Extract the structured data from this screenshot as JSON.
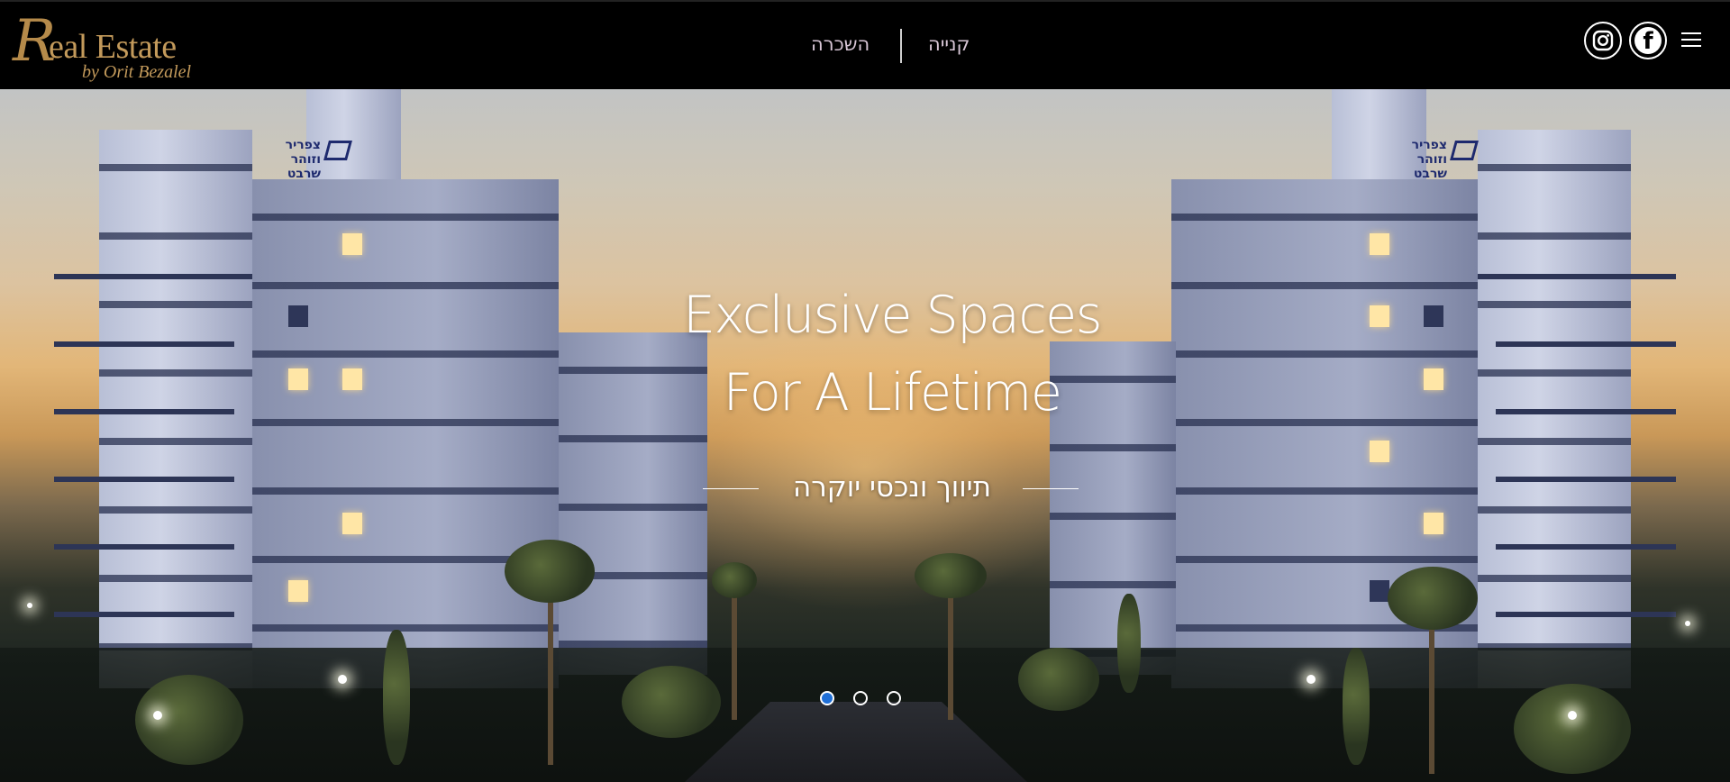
{
  "header": {
    "logo": {
      "initial": "R",
      "main": "eal Estate",
      "sub": "by Orit Bezalel"
    },
    "nav": {
      "rent_label": "השכרה",
      "buy_label": "קנייה"
    },
    "social": {
      "instagram_icon": "instagram-icon",
      "facebook_glyph": "f"
    },
    "menu_icon": "hamburger-menu-icon"
  },
  "hero": {
    "headline_line1": "Exclusive Spaces",
    "headline_line2": "For A Lifetime",
    "subline": "תיווך ונכסי יוקרה",
    "building_sign_line1": "צפריר וזוהר",
    "building_sign_line2": "שרבט",
    "slides": {
      "count": 3,
      "active_index": 0
    }
  },
  "colors": {
    "header_bg": "#000000",
    "logo_gold": "#c39a5b",
    "nav_text": "#d8c6d6",
    "active_dot": "#1f6fd6"
  }
}
